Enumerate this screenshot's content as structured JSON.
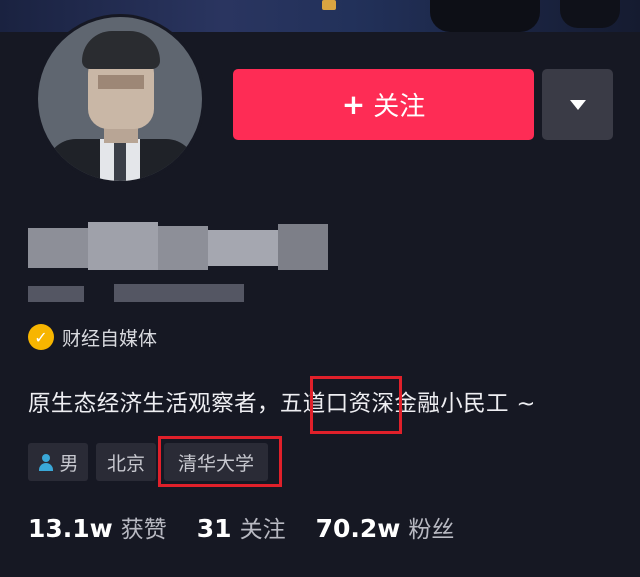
{
  "profile": {
    "follow_label": "关注",
    "follow_plus": "+",
    "verification": {
      "badge": "✓",
      "label": "财经自媒体"
    },
    "bio": {
      "before": "原生态经济生活观察者，",
      "highlight": "五道口",
      "after": "资深金融小民工 ~"
    },
    "tags": [
      "男",
      "北京",
      "清华大学"
    ],
    "stats": [
      {
        "value": "13.1w",
        "label": "获赞"
      },
      {
        "value": "31",
        "label": "关注"
      },
      {
        "value": "70.2w",
        "label": "粉丝"
      }
    ]
  },
  "colors": {
    "background": "#161823",
    "follow_button": "#fe2c55",
    "highlight_box": "#e0202a",
    "verify_badge": "#f7b500"
  }
}
